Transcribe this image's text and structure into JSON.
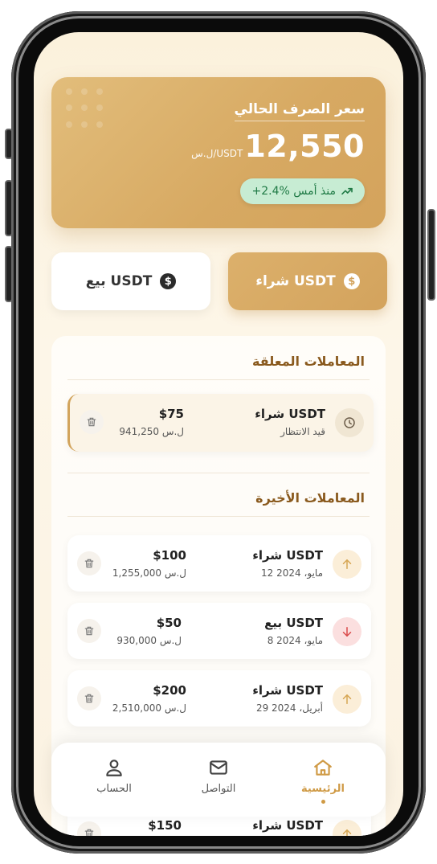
{
  "rate": {
    "title": "سعر الصرف الحالي",
    "value": "12,550",
    "unit": "ل.س/USDT",
    "change": "+2.4% منذ أمس"
  },
  "actions": {
    "buy_label": "شراء USDT",
    "sell_label": "بيع USDT",
    "coin_symbol": "$"
  },
  "pending": {
    "title": "المعاملات المعلقة",
    "items": [
      {
        "name": "شراء USDT",
        "status": "قيد الانتظار",
        "amount": "$75",
        "local": "941,250 ل.س",
        "icon": "clock-icon"
      }
    ]
  },
  "recent": {
    "title": "المعاملات الأخيرة",
    "items": [
      {
        "name": "شراء USDT",
        "date": "12 مايو، 2024",
        "amount": "$100",
        "local": "1,255,000 ل.س",
        "icon": "arrow-up-icon"
      },
      {
        "name": "بيع USDT",
        "date": "8 مايو، 2024",
        "amount": "$50",
        "local": "930,000 ل.س",
        "icon": "arrow-down-icon"
      },
      {
        "name": "شراء USDT",
        "date": "29 أبريل، 2024",
        "amount": "$200",
        "local": "2,510,000 ل.س",
        "icon": "arrow-up-icon"
      },
      {
        "name": "شراء USDT",
        "date": "",
        "amount": "$150",
        "local": "",
        "icon": "arrow-up-icon"
      }
    ]
  },
  "nav": {
    "home": "الرئيسية",
    "contact": "التواصل",
    "account": "الحساب"
  },
  "colors": {
    "accent": "#d3a35d",
    "positive": "#1f7a45",
    "negative": "#d94a4a"
  }
}
